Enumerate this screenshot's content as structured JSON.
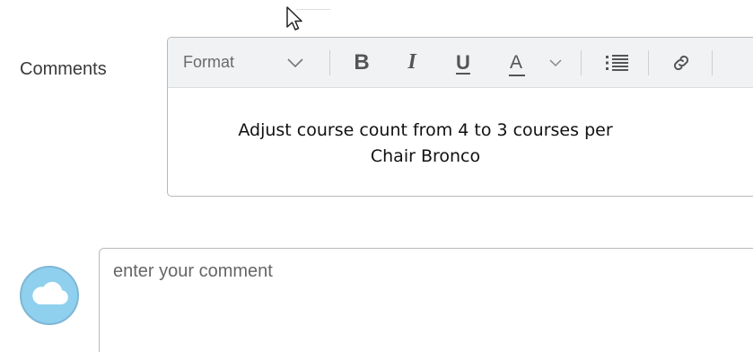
{
  "field": {
    "label": "Comments"
  },
  "editor": {
    "toolbar": {
      "format_label": "Format",
      "bold_label": "B",
      "italic_label": "I",
      "underline_label": "U",
      "text_color_label": "A"
    },
    "content_lines": [
      "Adjust course count from 4 to 3 courses per",
      "Chair Bronco"
    ]
  },
  "comment": {
    "placeholder": "enter your comment",
    "value": ""
  },
  "icons": {
    "format_dropdown": "chevron-down-icon",
    "text_color_dropdown": "chevron-down-icon",
    "list": "bulleted-list-icon",
    "link": "link-icon",
    "avatar": "cloud-icon",
    "cursor": "mouse-pointer-icon"
  },
  "colors": {
    "toolbar_bg": "#f0f2f4",
    "avatar_bg": "#8fd0ee",
    "border": "#b9b9b9"
  }
}
